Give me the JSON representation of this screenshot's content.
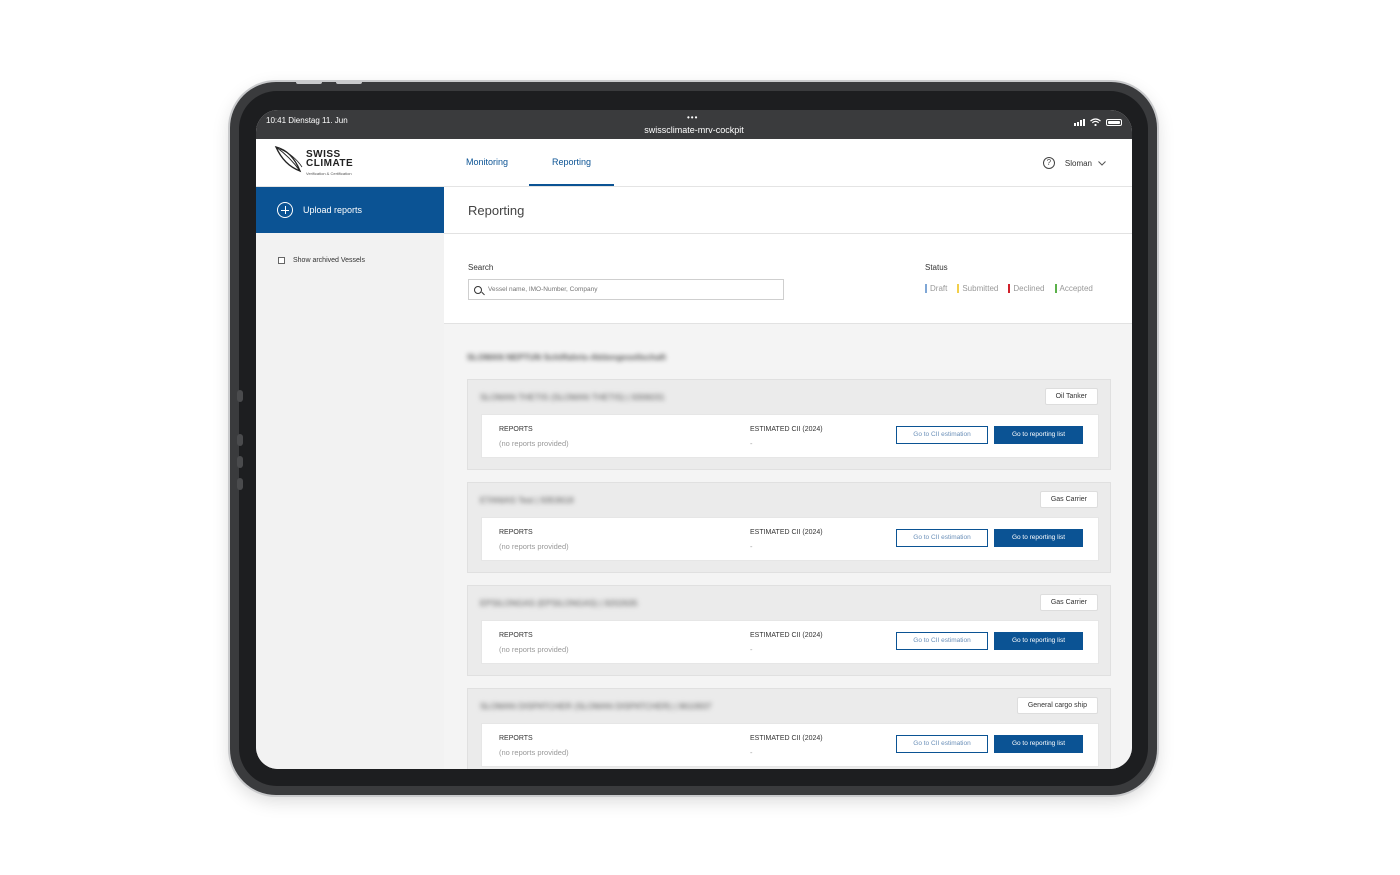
{
  "statusbar": {
    "time": "10:41  Dienstag  11. Jun",
    "dots": "•••",
    "url": "swissclimate-mrv-cockpit"
  },
  "logo": {
    "line1": "SWISS",
    "line2": "CLIMATE",
    "tagline": "Verification & Certification"
  },
  "nav": {
    "tabs": [
      {
        "label": "Monitoring"
      },
      {
        "label": "Reporting"
      }
    ],
    "user": "Sloman",
    "help": "?"
  },
  "sidebar": {
    "upload_label": "Upload reports",
    "archived_label": "Show archived Vessels"
  },
  "page": {
    "title": "Reporting"
  },
  "filters": {
    "search_label": "Search",
    "search_placeholder": "Vessel name, IMO-Number, Company",
    "status_label": "Status",
    "statuses": [
      {
        "label": "Draft",
        "color": "#7fa7d6"
      },
      {
        "label": "Submitted",
        "color": "#f2cf4a"
      },
      {
        "label": "Declined",
        "color": "#d0212b"
      },
      {
        "label": "Accepted",
        "color": "#5bb14a"
      }
    ]
  },
  "company": "SLOMAN NEPTUN Schiffahrts-Aktiengesellschaft",
  "card_labels": {
    "reports": "REPORTS",
    "no_reports": "(no reports provided)",
    "cii": "ESTIMATED CII (2024)",
    "cii_value": "-",
    "btn_cii": "Go to CII estimation",
    "btn_list": "Go to reporting list"
  },
  "vessels": [
    {
      "name": "SLOMAN THETIS (SLOMAN THETIS)   |   9306031",
      "type": "Oil Tanker"
    },
    {
      "name": "ETANIAS Test   |   9353618",
      "type": "Gas Carrier"
    },
    {
      "name": "EPSILONGAS (EPSILONGAS)   |   9202635",
      "type": "Gas Carrier"
    },
    {
      "name": "SLOMAN DISPATCHER (SLOMAN DISPATCHER)   |   9610937",
      "type": "General cargo ship"
    }
  ]
}
